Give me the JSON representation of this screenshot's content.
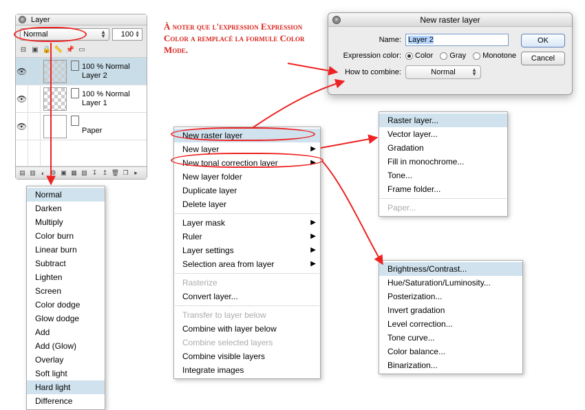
{
  "layer_panel": {
    "title": "Layer",
    "blend_mode": "Normal",
    "opacity": "100",
    "layers": [
      {
        "opacity": "100 %",
        "mode": "Normal",
        "name": "Layer 2",
        "selected": true,
        "checker": true
      },
      {
        "opacity": "100 %",
        "mode": "Normal",
        "name": "Layer 1",
        "selected": false,
        "checker": true
      },
      {
        "opacity": "",
        "mode": "",
        "name": "Paper",
        "selected": false,
        "checker": false
      }
    ]
  },
  "note_text": "À noter que l'expression Expression Color a remplacé la formule Color Mode.",
  "dialog": {
    "title": "New raster layer",
    "name_label": "Name:",
    "name_value": "Layer 2",
    "expr_label": "Expression color:",
    "opts": [
      "Color",
      "Gray",
      "Monotone"
    ],
    "combine_label": "How to combine:",
    "combine_value": "Normal",
    "ok": "OK",
    "cancel": "Cancel"
  },
  "blend_modes": [
    "Normal",
    "Darken",
    "Multiply",
    "Color burn",
    "Linear burn",
    "Subtract",
    "Lighten",
    "Screen",
    "Color dodge",
    "Glow dodge",
    "Add",
    "Add (Glow)",
    "Overlay",
    "Soft light",
    "Hard light",
    "Difference"
  ],
  "blend_highlight": [
    "Normal",
    "Hard light"
  ],
  "main_menu": {
    "g1": [
      "New raster layer",
      "New layer",
      "New tonal correction layer",
      "New layer folder",
      "Duplicate layer",
      "Delete layer"
    ],
    "g1_sub": {
      "New layer": true,
      "New tonal correction layer": true
    },
    "g1_hl": "New raster layer",
    "g2": [
      "Layer mask",
      "Ruler",
      "Layer settings",
      "Selection area from layer"
    ],
    "g3": [
      "Rasterize",
      "Convert layer..."
    ],
    "g3_dis": [
      "Rasterize"
    ],
    "g4": [
      "Transfer to layer below",
      "Combine with layer below",
      "Combine selected layers",
      "Combine visible layers",
      "Integrate images"
    ],
    "g4_dis": [
      "Transfer to layer below",
      "Combine selected layers"
    ]
  },
  "sub_menu_layer": {
    "items": [
      "Raster layer...",
      "Vector layer...",
      "Gradation",
      "Fill in monochrome...",
      "Tone...",
      "Frame folder..."
    ],
    "hl": "Raster layer...",
    "after_sep": [
      "Paper..."
    ],
    "after_dis": [
      "Paper..."
    ]
  },
  "sub_menu_tonal": {
    "items": [
      "Brightness/Contrast...",
      "Hue/Saturation/Luminosity...",
      "Posterization...",
      "Invert gradation",
      "Level correction...",
      "Tone curve...",
      "Color balance...",
      "Binarization..."
    ],
    "hl": "Brightness/Contrast..."
  }
}
